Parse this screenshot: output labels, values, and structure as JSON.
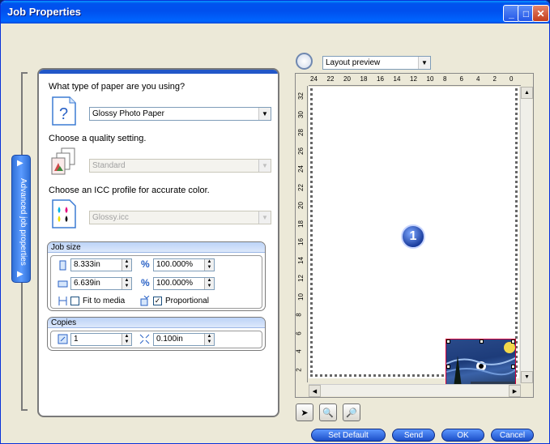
{
  "window": {
    "title": "Job Properties"
  },
  "sidebar": {
    "tab_label": "Advanced job properties"
  },
  "paper": {
    "question": "What type of paper are you using?",
    "selected": "Glossy Photo Paper"
  },
  "quality": {
    "question": "Choose a quality setting.",
    "selected": "Standard"
  },
  "icc": {
    "question": "Choose an ICC profile for accurate color.",
    "selected": "Glossy.icc"
  },
  "job_size": {
    "title": "Job size",
    "width": "8.333in",
    "height": "6.639in",
    "width_pct": "100.000%",
    "height_pct": "100.000%",
    "pct_symbol": "%",
    "fit_to_media_label": "Fit to media",
    "fit_to_media_checked": false,
    "proportional_label": "Proportional",
    "proportional_checked": true
  },
  "copies": {
    "title": "Copies",
    "count": "1",
    "spacing": "0.100in"
  },
  "preview": {
    "view_selected": "Layout preview",
    "hruler_labels": [
      "24",
      "22",
      "20",
      "18",
      "16",
      "14",
      "12",
      "10",
      "8",
      "6",
      "4",
      "2",
      "0"
    ],
    "vruler_labels": [
      "32",
      "30",
      "28",
      "26",
      "24",
      "22",
      "20",
      "18",
      "16",
      "14",
      "12",
      "10",
      "8",
      "6",
      "4",
      "2"
    ],
    "job_number": "1"
  },
  "buttons": {
    "set_default": "Set Default",
    "send": "Send",
    "ok": "OK",
    "cancel": "Cancel"
  }
}
